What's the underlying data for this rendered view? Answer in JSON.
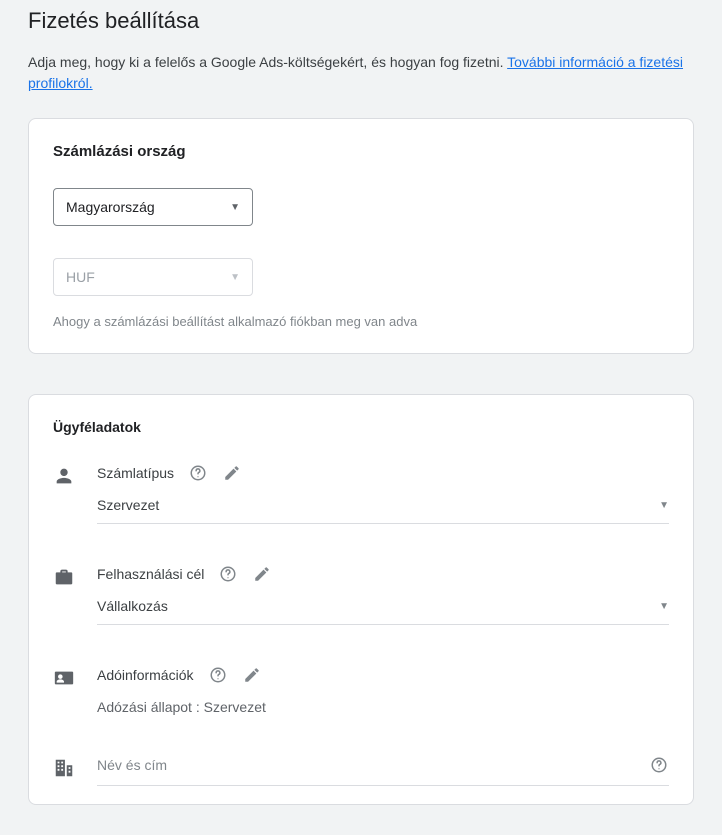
{
  "header": {
    "title": "Fizetés beállítása",
    "intro_text": "Adja meg, hogy ki a felelős a Google Ads-költségekért, és hogyan fog fizetni. ",
    "intro_link": "További információ a fizetési profilokról."
  },
  "billing_country": {
    "title": "Számlázási ország",
    "country": "Magyarország",
    "currency": "HUF",
    "hint": "Ahogy a számlázási beállítást alkalmazó fiókban meg van adva"
  },
  "customer": {
    "title": "Ügyféladatok",
    "account_type": {
      "label": "Számlatípus",
      "value": "Szervezet"
    },
    "usage": {
      "label": "Felhasználási cél",
      "value": "Vállalkozás"
    },
    "tax": {
      "label": "Adóinformációk",
      "status_label": "Adózási állapot :",
      "status_value": "Szervezet"
    },
    "name_address": {
      "placeholder": "Név és cím"
    }
  }
}
